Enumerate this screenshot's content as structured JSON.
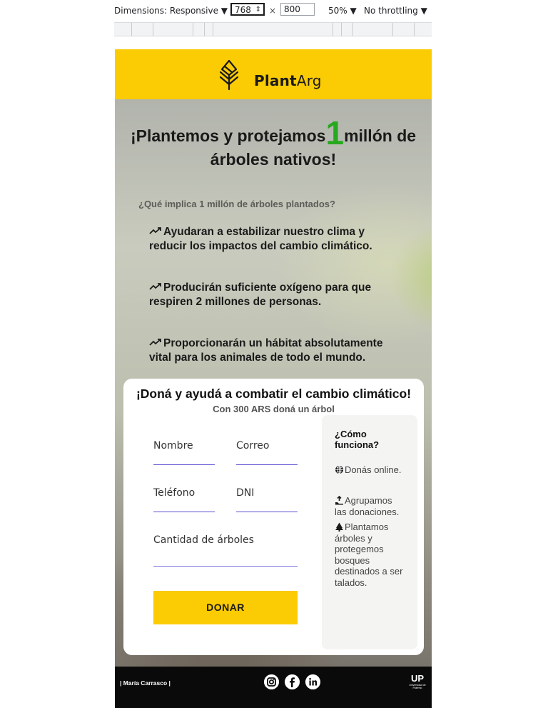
{
  "devtools": {
    "dimensions_label": "Dimensions: Responsive ▼",
    "width_value": "768",
    "height_value": "800",
    "times": "×",
    "zoom_label": "50% ▼",
    "throttle_label": "No throttling ▼"
  },
  "header": {
    "brand_bold": "Plant",
    "brand_thin": "Arg"
  },
  "hero": {
    "title_part1": "¡Plantemos y protejamos",
    "title_number": "1",
    "title_part2": "millón de árboles nativos!",
    "question": "¿Qué implica 1 millón de árboles plantados?",
    "benefits": [
      "Ayudaran a estabilizar nuestro clima y reducir los impactos del cambio climático.",
      "Producirán suficiente oxígeno para que respiren 2 millones de personas.",
      "Proporcionarán un hábitat absolutamente vital para los animales de todo el mundo."
    ]
  },
  "donation": {
    "title": "¡Doná y ayudá a combatir el cambio climático!",
    "subtitle": "Con 300 ARS doná un árbol",
    "fields": {
      "nombre": "Nombre",
      "correo": "Correo",
      "telefono": "Teléfono",
      "dni": "DNI",
      "cantidad": "Cantidad de árboles"
    },
    "button_label": "DONAR",
    "how": {
      "title": "¿Cómo funciona?",
      "steps": [
        "Donás online.",
        "Agrupamos las donaciones.",
        "Plantamos árboles y protegemos bosques destinados a ser talados."
      ]
    }
  },
  "footer": {
    "credit": "| María Carrasco |",
    "up_logo": "UP",
    "up_subtext": "Universidad de Palermo"
  },
  "colors": {
    "brand_yellow": "#fbcb04",
    "accent_green": "#27a91f",
    "input_underline": "#5a4fd0",
    "footer_bg": "#0a0a0a"
  }
}
